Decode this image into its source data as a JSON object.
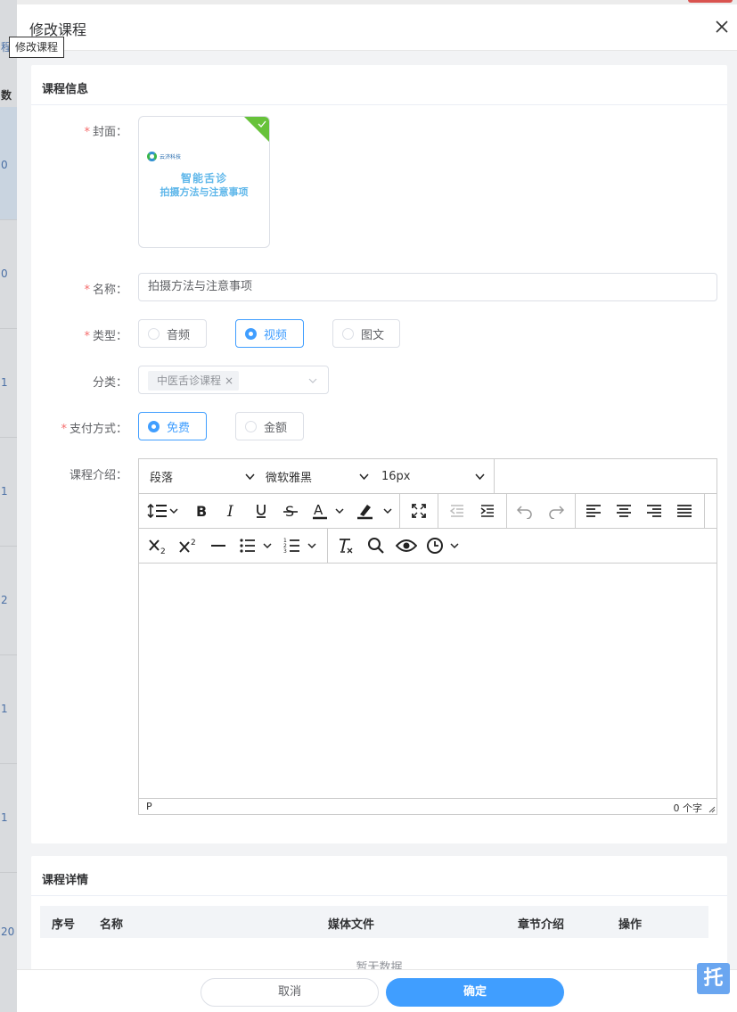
{
  "background": {
    "column_header": "数",
    "tab_fragment": "程",
    "row_values": [
      "0",
      "0",
      "1",
      "1",
      "2",
      "1",
      "1",
      "20"
    ]
  },
  "drawer": {
    "title": "修改课程",
    "tooltip": "修改课程",
    "close_icon": "close-icon"
  },
  "course_info": {
    "section_title": "课程信息",
    "cover": {
      "label": "封面：",
      "logo_text": "云济科技",
      "title_line1": "智能舌诊",
      "title_line2": "拍摄方法与注意事项"
    },
    "name": {
      "label": "名称：",
      "value": "拍摄方法与注意事项"
    },
    "type": {
      "label": "类型：",
      "options": [
        "音频",
        "视频",
        "图文"
      ],
      "selected": "视频"
    },
    "category": {
      "label": "分类：",
      "tag": "中医舌诊课程"
    },
    "payment": {
      "label": "支付方式：",
      "options": [
        "免费",
        "金额"
      ],
      "selected": "免费"
    },
    "intro": {
      "label": "课程介绍：",
      "editor": {
        "block_format": "段落",
        "font_family": "微软雅黑",
        "font_size": "16px",
        "status_path": "P",
        "word_count": "0 个字"
      }
    }
  },
  "course_detail": {
    "section_title": "课程详情",
    "columns": [
      "序号",
      "名称",
      "媒体文件",
      "章节介绍",
      "操作"
    ],
    "empty_text": "暂无数据"
  },
  "footer": {
    "cancel_label": "取消",
    "ok_label": "确定"
  },
  "float_badge": "托",
  "colors": {
    "primary": "#409eff",
    "required": "#f56c6c",
    "success": "#67c23a"
  }
}
